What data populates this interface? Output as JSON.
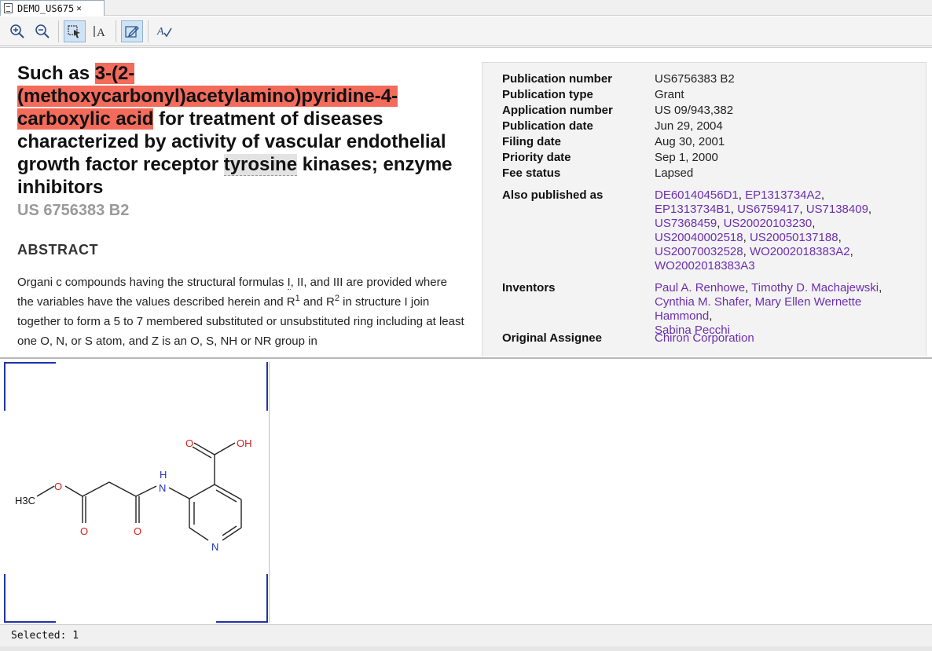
{
  "tab": {
    "title": "DEMO_US675",
    "close_glyph": "✕"
  },
  "toolbar": {
    "buttons": [
      {
        "name": "zoom-in-icon"
      },
      {
        "name": "zoom-out-icon"
      },
      {
        "name": "select-tool-icon",
        "active": true
      },
      {
        "name": "text-tool-icon"
      },
      {
        "name": "edit-tool-icon",
        "active": true
      },
      {
        "name": "spellcheck-icon"
      }
    ]
  },
  "title": {
    "pre": "Such as ",
    "highlight": "3-(2-(methoxycarbonyl)acetylamino)pyridine-4-carboxylic acid",
    "mid": " for treatment of diseases characterized by activity of vascular endothelial growth factor receptor ",
    "highlight2": "tyrosine",
    "post": " kinases; enzyme inhibitors"
  },
  "publication_display": "US 6756383 B2",
  "abstract": {
    "heading": "ABSTRACT",
    "p1": "Organi c compounds having the structural formulas ",
    "p1_formula": "I",
    "p2": ", II, and III are provided where the variables have the values described herein and R",
    "sup1": "1",
    "p3": " and R",
    "sup2": "2",
    "p4": " in structure I join together to form a 5 to 7 membered substituted or unsubstituted ring including at least one O, N, or S atom, and Z is an O, S, NH or NR group in"
  },
  "meta": {
    "rows": [
      {
        "label": "Publication number",
        "value": "US6756383 B2"
      },
      {
        "label": "Publication type",
        "value": "Grant"
      },
      {
        "label": "Application number",
        "value": "US 09/943,382"
      },
      {
        "label": "Publication date",
        "value": "Jun 29, 2004"
      },
      {
        "label": "Filing date",
        "value": "Aug 30, 2001"
      },
      {
        "label": "Priority date",
        "value": "Sep 1, 2000"
      },
      {
        "label": "Fee status",
        "value": "Lapsed"
      }
    ],
    "also_published_label": "Also published as",
    "also_published": [
      "DE60140456D1",
      "EP1313734A2",
      "EP1313734B1",
      "US6759417",
      "US7138409",
      "US7368459",
      "US20020103230",
      "US20040002518",
      "US20050137188",
      "US20070032528",
      "WO2002018383A2",
      "WO2002018383A3"
    ],
    "inventors_label": "Inventors",
    "inventors": [
      "Paul A. Renhowe",
      "Timothy D. Machajewski",
      "Cynthia M. Shafer",
      "Mary Ellen Wernette Hammond",
      "Sabina Pecchi"
    ],
    "assignee_label": "Original Assignee",
    "assignee": "Chiron Corporation"
  },
  "structure": {
    "atoms": {
      "h3c": "H3C",
      "o1": "O",
      "o2": "O",
      "o3": "O",
      "nh_n": "N",
      "nh_h": "H",
      "n_ring": "N",
      "o_acid": "O",
      "oh": "OH"
    }
  },
  "status": {
    "text": "Selected: 1"
  }
}
